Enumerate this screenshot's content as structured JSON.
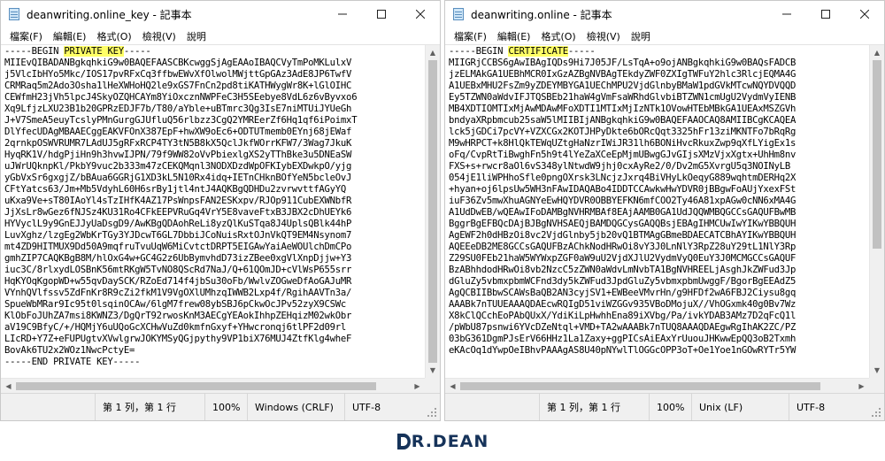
{
  "windows": [
    {
      "title": "deanwriting.online_key - 記事本",
      "menu": [
        "檔案(F)",
        "編輯(E)",
        "格式(O)",
        "檢視(V)",
        "說明"
      ],
      "content": {
        "header_prefix": "-----BEGIN ",
        "header_highlight": "PRIVATE KEY",
        "header_suffix": "-----",
        "lines": [
          "MIIEvQIBADANBgkqhkiG9w0BAQEFAASCBKcwggSjAgEAAoIBAQCVyTmPoMKLulxV",
          "j5VlcIbHYo5Mkc/IOS17pvRFxCq3ffbwEWvXfOlwolMWjttGpGAz3AdE8JP6TwfV",
          "CRMRaq5m2Ado3Osha1lHeXWHoHQ2le9xGS7FnCn2pd8tiKATHWygWr8K+lGlOIHC",
          "CEWfmH23jVh5lpcJ4SkyOZQHCAYm8YiOxcznNWPFeC3H5SEebye8VdL6z6vByvxo6",
          "Xq9LfjzLXU23B1b20GPRzEDJF7b/T80/aYble+uBTmrc3Qg3IsE7niMTUiJYUeGh",
          "J+V7SmeA5euyTcslyPMnGurgGJUfluQ56rlbzz3CgQ2YMREerZf6Hq1qf6iPoimxT",
          "DlYfecUDAgMBAAECggEAKVFOnX387EpF+hwXW9oEc6+ODTUTmemb0EYnj68jEWaf",
          "2qrnkpOSWVRUMR7LAdUJ5gRFxRCP4TY3tN5B8kX5QclJkfWOrrKFW7/3Wag7JkuK",
          "HyqRK1V/hdgPjiHn9h3hvwIJPN/79f9WW82oVvPbiexlgXS2yTThBke3u5DNEaSW",
          "uJWrUQknpKl/PkbY9vuc2b333m47zCEKQMqnl3NODXDzdWpOFKIybEXDwkpO/yjg",
          "yGbVxSr6gxgjZ/bBAua6GGRjG1XD3kL5N10Rx4idq+IETnCHknBOfYeN5bcleOvJ",
          "CFtYatcs63/Jm+Mb5VdyhL60H6srBy1jtl4ntJ4AQKBgQDHDu2zvrwvttfAGyYQ",
          "uKxa9Ve+sT80IAoYl4sTzIHfK4AZ17PsWnpsFAN2ESKxpv/RJOp911CubEXWNbfR",
          "JjXsLr8wGez6fNJSz4KU31Ro4CFkEEPVRuGq4VrY5E8vaveFtxB3JBX2cDhUEYk6",
          "HYVyclL9y9GnEJJyUaDsgD9/AwKBgQDAohReLi8yzQlKuSTqa8J4UplsQBlk44hP",
          "LuvXghz/lzgEg2WbKrTGy3YJDcwT6GL7DbbiJCoNuisRxtOJnVkQT9EM4Nsynom7",
          "mt4ZD9HITMUX9Dd50A9mqfruTvuUqW6MiCvtctDRPT5EIGAwYaiAeWOUlchDmCPo",
          "gmhZIP7CAQKBgB8M/hlOxG4w+GC4G2z6UbBymvhdD73izZBee0xgVlXnpDjjw+Y3",
          "iuc3C/8rlxydLOSBnK56mtRKgW5TvNO8QScRd7NaJ/Q+61QOmJD+cVlWsP655srr",
          "HqKYOqKgopWD+w55qvDaySCK/RZoEd714f4jbSu30oFb/WwlvZOGweDfAoGAJuMR",
          "VYnhQVlfssv5ZdFnKr8R9cZi2fkM1V9VgOXlUMhzqIWWB2Lxp4f/RgihAAVTn3a/",
          "SpueWbMRar9Ic95t0lsqinOCAw/6lgM7frew08ybSBJ6pCkwOcJPv52zyX9CSWc",
          "KlObFoJUhZA7msi8KWNZ3/DgQrT92rwosKnM3AECgYEAokIhhpZEHqizM02wkObr",
          "aV19C9BfyC/+/HQMjY6uUQoGcXCHwVuZd0kmfnGxyf+YHwcronqj6tlPF2d09rl",
          "LIcRD+Y7Z+eFUPUgtvXVwlgrwJOKYMSyQGjpythy9VP1biX76MUJ4ZtfKlg4wheF",
          "BovAk6TU2x2WOz1NwcPctyE=",
          "-----END PRIVATE KEY-----"
        ]
      },
      "status": {
        "position": "第 1 列，第 1 行",
        "zoom": "100%",
        "line_ending": "Windows (CRLF)",
        "encoding": "UTF-8"
      },
      "v_thumb": {
        "start": 0.0,
        "fraction": 1.0
      },
      "h_thumb": {
        "start": 0.0,
        "fraction": 0.92
      }
    },
    {
      "title": "deanwriting.online - 記事本",
      "menu": [
        "檔案(F)",
        "編輯(E)",
        "格式(O)",
        "檢視(V)",
        "說明"
      ],
      "content": {
        "header_prefix": "-----BEGIN ",
        "header_highlight": "CERTIFICATE",
        "header_suffix": "-----",
        "lines": [
          "MIIGRjCCBS6gAwIBAgIQDs9Hi7J05JF/LsTqA+o9ojANBgkqhkiG9w0BAQsFADCB",
          "jzELMAkGA1UEBhMCR0IxGzAZBgNVBAgTEkdyZWF0ZXIgTWFuY2hlc3RlcjEQMA4G",
          "A1UEBxMHU2FsZm9yZDEYMBYGA1UEChMPU2VjdGlnbyBMaW1pdGVkMTcwNQYDVQQD",
          "Ey5TZWN0aWdvIFJTQSBEb21haW4gVmFsaWRhdGlvbiBTZWN1cmUgU2VydmVyIENB",
          "MB4XDTIOMTIxMjAwMDAwMFoXDTI1MTIxMjIzNTk1OVowHTEbMBkGA1UEAxMSZGVh",
          "bndyaXRpbmcub25saW5lMIIBIjANBgkqhkiG9w0BAQEFAAOCAQ8AMIIBCgKCAQEA",
          "lck5jGDCi7pcVY+VZXCGx2KOTJHPyDkte6bORcQqt3325hFr13ziMKNTFo7bRqRg",
          "M9wHRPCT+k8HlQkTEWqUZtgHaNzrIWiJR31lh6BONiHvcRkuxZwp9qXfLYigEx1s",
          "oFq/CvpRtTiBwghFn5h9t4lYeZaXCeEpMjmUBwgGJvGIjsXMzVjxXgtx+UhHm8nv",
          "FXS+s+rwcr8aOl6vS348ylNtwdW9jhj0cxAyRe2/0/Dv2mG5XvrgU5q3NOINyLB",
          "054jE1liWPHhoSfle0pngOXrsk3LNcjzJxrq4BiVHyLkOeqyG889wqhtmDERHq2X",
          "+hyan+oj6lpsUw5WH3nFAwIDAQABo4IDDTCCAwkwHwYDVR0jBBgwFoAUjYxexFSt",
          "iuF36Zv5mwXhuAGNYeEwHQYDVR0OBBYEFKN6mfCOO2Ty46A81xpAGw0cNN6xMA4G",
          "A1UdDwEB/wQEAwIFoDAMBgNVHRMBAf8EAjAAMB0GA1UdJQQWMBQGCCsGAQUFBwMB",
          "BggrBgEFBQcDAjBJBgNVHSAEQjBAMDQGCysGAQQBsjEBAgIHMCUwIwYIKwYBBQUH",
          "AgEWF2h0dHBzOi8vc2VjdGlnby5jb20vQ1BTMAgGBmeBDAECATCBhAYIKwYBBQUH",
          "AQEEeDB2ME8GCCsGAQUFBzAChkNodHRwOi8vY3J0LnNlY3RpZ28uY29tL1NlY3Rp",
          "Z29SU0FEb21haW5WYWxpZGF0aW9uU2VjdXJlU2VydmVyQ0EuY3J0MCMGCCsGAQUF",
          "BzABhhdodHRwOi8vb2NzcC5zZWN0aWdvLmNvbTA1BgNVHREELjAsghJkZWFud3Jp",
          "dGluZy5vbmxpbmWCFnd3dy5kZWFud3JpdGluZy5vbmxpbmUwggF/BgorBgEEAdZ5",
          "AgQCBIIBbwSCAWsBaQB2AN3cyjSV1+EWBeeVMvrHn/g9HFDf2wA6FBJ2Ciysu8gq",
          "AAABk7nTUUEAAAQDAEcwRQIgD51viWZGGv935VBoDMojuX//VhOGxmk40g0Bv7Wz",
          "X8kClQCchEoPAbQUxX/YdiKiLpHwhhEna89iXVbg/Pa/ivkYDAB3AMz7D2qFcQ1l",
          "/pWbU87psnwi6YVcDZeNtql+VMD+TA2wAAABk7nTUQ8AAAQDAEgwRgIhAK2ZC/PZ",
          "03bG361DgmPJsErV66HHz1La1Zaxy+ggPICsAiEAxYrUuouJHKwwEpQQ3oB2Txmh",
          "eKAcOq1dYwpOeIBhvPAAAgAS8U40pNYwlTlOGGcOPP3oT+Oe1Yoe1nGOwRYTr5YW"
        ]
      },
      "status": {
        "position": "第 1 列，第 1 行",
        "zoom": "100%",
        "line_ending": "Unix (LF)",
        "encoding": "UTF-8"
      },
      "v_thumb": {
        "start": 0.0,
        "fraction": 0.62
      },
      "h_thumb": {
        "start": 0.0,
        "fraction": 0.92
      }
    }
  ],
  "logo": {
    "text": "R.DEAN",
    "mark_letter": "D",
    "color": "#16335a"
  },
  "colors": {
    "highlight": "#ffff66",
    "status_bg": "#f0f0f0"
  }
}
